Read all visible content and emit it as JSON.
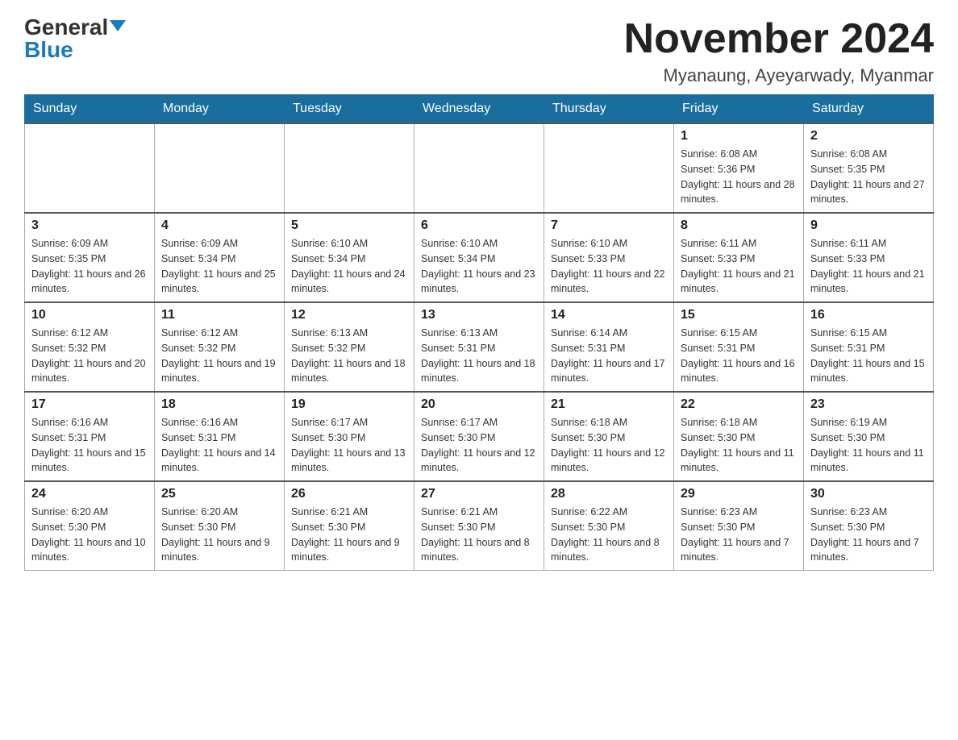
{
  "header": {
    "logo_general": "General",
    "logo_blue": "Blue",
    "month_title": "November 2024",
    "location": "Myanaung, Ayeyarwady, Myanmar"
  },
  "days_of_week": [
    "Sunday",
    "Monday",
    "Tuesday",
    "Wednesday",
    "Thursday",
    "Friday",
    "Saturday"
  ],
  "weeks": [
    [
      {
        "day": "",
        "info": ""
      },
      {
        "day": "",
        "info": ""
      },
      {
        "day": "",
        "info": ""
      },
      {
        "day": "",
        "info": ""
      },
      {
        "day": "",
        "info": ""
      },
      {
        "day": "1",
        "info": "Sunrise: 6:08 AM\nSunset: 5:36 PM\nDaylight: 11 hours and 28 minutes."
      },
      {
        "day": "2",
        "info": "Sunrise: 6:08 AM\nSunset: 5:35 PM\nDaylight: 11 hours and 27 minutes."
      }
    ],
    [
      {
        "day": "3",
        "info": "Sunrise: 6:09 AM\nSunset: 5:35 PM\nDaylight: 11 hours and 26 minutes."
      },
      {
        "day": "4",
        "info": "Sunrise: 6:09 AM\nSunset: 5:34 PM\nDaylight: 11 hours and 25 minutes."
      },
      {
        "day": "5",
        "info": "Sunrise: 6:10 AM\nSunset: 5:34 PM\nDaylight: 11 hours and 24 minutes."
      },
      {
        "day": "6",
        "info": "Sunrise: 6:10 AM\nSunset: 5:34 PM\nDaylight: 11 hours and 23 minutes."
      },
      {
        "day": "7",
        "info": "Sunrise: 6:10 AM\nSunset: 5:33 PM\nDaylight: 11 hours and 22 minutes."
      },
      {
        "day": "8",
        "info": "Sunrise: 6:11 AM\nSunset: 5:33 PM\nDaylight: 11 hours and 21 minutes."
      },
      {
        "day": "9",
        "info": "Sunrise: 6:11 AM\nSunset: 5:33 PM\nDaylight: 11 hours and 21 minutes."
      }
    ],
    [
      {
        "day": "10",
        "info": "Sunrise: 6:12 AM\nSunset: 5:32 PM\nDaylight: 11 hours and 20 minutes."
      },
      {
        "day": "11",
        "info": "Sunrise: 6:12 AM\nSunset: 5:32 PM\nDaylight: 11 hours and 19 minutes."
      },
      {
        "day": "12",
        "info": "Sunrise: 6:13 AM\nSunset: 5:32 PM\nDaylight: 11 hours and 18 minutes."
      },
      {
        "day": "13",
        "info": "Sunrise: 6:13 AM\nSunset: 5:31 PM\nDaylight: 11 hours and 18 minutes."
      },
      {
        "day": "14",
        "info": "Sunrise: 6:14 AM\nSunset: 5:31 PM\nDaylight: 11 hours and 17 minutes."
      },
      {
        "day": "15",
        "info": "Sunrise: 6:15 AM\nSunset: 5:31 PM\nDaylight: 11 hours and 16 minutes."
      },
      {
        "day": "16",
        "info": "Sunrise: 6:15 AM\nSunset: 5:31 PM\nDaylight: 11 hours and 15 minutes."
      }
    ],
    [
      {
        "day": "17",
        "info": "Sunrise: 6:16 AM\nSunset: 5:31 PM\nDaylight: 11 hours and 15 minutes."
      },
      {
        "day": "18",
        "info": "Sunrise: 6:16 AM\nSunset: 5:31 PM\nDaylight: 11 hours and 14 minutes."
      },
      {
        "day": "19",
        "info": "Sunrise: 6:17 AM\nSunset: 5:30 PM\nDaylight: 11 hours and 13 minutes."
      },
      {
        "day": "20",
        "info": "Sunrise: 6:17 AM\nSunset: 5:30 PM\nDaylight: 11 hours and 12 minutes."
      },
      {
        "day": "21",
        "info": "Sunrise: 6:18 AM\nSunset: 5:30 PM\nDaylight: 11 hours and 12 minutes."
      },
      {
        "day": "22",
        "info": "Sunrise: 6:18 AM\nSunset: 5:30 PM\nDaylight: 11 hours and 11 minutes."
      },
      {
        "day": "23",
        "info": "Sunrise: 6:19 AM\nSunset: 5:30 PM\nDaylight: 11 hours and 11 minutes."
      }
    ],
    [
      {
        "day": "24",
        "info": "Sunrise: 6:20 AM\nSunset: 5:30 PM\nDaylight: 11 hours and 10 minutes."
      },
      {
        "day": "25",
        "info": "Sunrise: 6:20 AM\nSunset: 5:30 PM\nDaylight: 11 hours and 9 minutes."
      },
      {
        "day": "26",
        "info": "Sunrise: 6:21 AM\nSunset: 5:30 PM\nDaylight: 11 hours and 9 minutes."
      },
      {
        "day": "27",
        "info": "Sunrise: 6:21 AM\nSunset: 5:30 PM\nDaylight: 11 hours and 8 minutes."
      },
      {
        "day": "28",
        "info": "Sunrise: 6:22 AM\nSunset: 5:30 PM\nDaylight: 11 hours and 8 minutes."
      },
      {
        "day": "29",
        "info": "Sunrise: 6:23 AM\nSunset: 5:30 PM\nDaylight: 11 hours and 7 minutes."
      },
      {
        "day": "30",
        "info": "Sunrise: 6:23 AM\nSunset: 5:30 PM\nDaylight: 11 hours and 7 minutes."
      }
    ]
  ]
}
